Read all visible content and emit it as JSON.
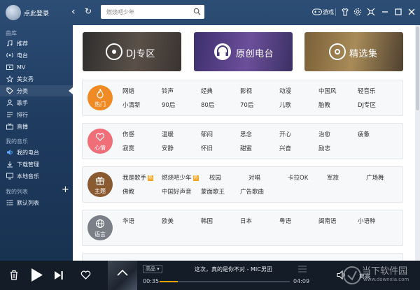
{
  "header": {
    "login_label": "点此登录",
    "search_placeholder": "燃烧吧少年",
    "game_label": "游戏"
  },
  "sidebar": {
    "section_library": "曲库",
    "library_items": [
      {
        "label": "推荐",
        "icon": "thumb-icon"
      },
      {
        "label": "电台",
        "icon": "radio-icon"
      },
      {
        "label": "MV",
        "icon": "mv-icon"
      },
      {
        "label": "美女秀",
        "icon": "star-icon"
      },
      {
        "label": "分类",
        "icon": "tag-icon"
      },
      {
        "label": "歌手",
        "icon": "singer-icon"
      },
      {
        "label": "排行",
        "icon": "rank-icon"
      },
      {
        "label": "直播",
        "icon": "live-icon"
      }
    ],
    "section_my_music": "我的音乐",
    "my_items": [
      {
        "label": "我的电台",
        "icon": "speaker-icon"
      },
      {
        "label": "下载管理",
        "icon": "download-icon"
      },
      {
        "label": "本地音乐",
        "icon": "monitor-icon"
      }
    ],
    "section_my_list": "我的列表",
    "list_items": [
      {
        "label": "默认列表",
        "icon": "list-icon"
      }
    ],
    "active": "分类"
  },
  "banners": [
    {
      "label": "DJ专区",
      "color": "#3b3a3a"
    },
    {
      "label": "原创电台",
      "color": "#4a3a78"
    },
    {
      "label": "精选集",
      "color": "#6b5a3a"
    }
  ],
  "categories": [
    {
      "label": "热门",
      "color": "#f08a24",
      "rows": [
        [
          "网络",
          "铃声",
          "经典",
          "影视",
          "动漫",
          "中国风",
          "轻音乐"
        ],
        [
          "小清新",
          "90后",
          "80后",
          "70后",
          "儿歌",
          "胎教",
          "DJ专区"
        ]
      ]
    },
    {
      "label": "心情",
      "color": "#f06e78",
      "rows": [
        [
          "伤感",
          "温暖",
          "郁闷",
          "思念",
          "开心",
          "治愈",
          "疲惫"
        ],
        [
          "寂寞",
          "安静",
          "怀旧",
          "甜蜜",
          "兴奋",
          "励志"
        ]
      ]
    },
    {
      "label": "主题",
      "color": "#8a5a30",
      "rows": [
        [
          "我是歌手",
          "燃烧吧少年",
          "校园",
          "对唱",
          "卡拉OK",
          "军旅",
          "广场舞"
        ],
        [
          "佛教",
          "中国好声音",
          "蒙面歌王",
          "广告歌曲"
        ]
      ]
    },
    {
      "label": "语言",
      "color": "#7a7f88",
      "rows": [
        [
          "华语",
          "欧美",
          "韩国",
          "日本",
          "粤语",
          "闽南语",
          "小语种"
        ]
      ]
    }
  ],
  "hot_badge": "热",
  "player": {
    "quality": "高品",
    "song": "这次，真的是你不对 - MIC男团",
    "current_time": "00:35",
    "total_time": "04:09",
    "progress": 0.14,
    "volume_label": "离高"
  },
  "watermark": {
    "title": "当下软件园",
    "sub": "www.downxia.com"
  }
}
